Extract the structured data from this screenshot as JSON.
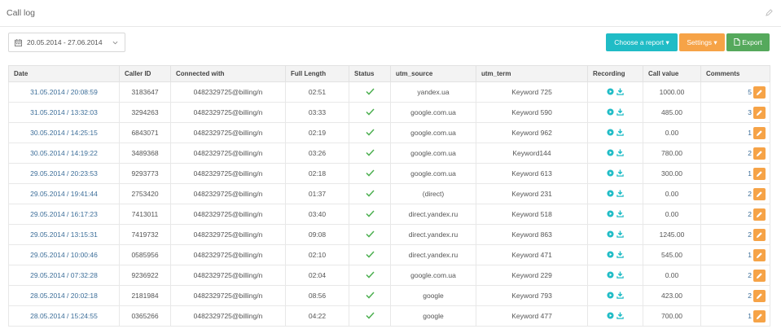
{
  "header": {
    "title": "Call log"
  },
  "toolbar": {
    "date_range": "20.05.2014 - 27.06.2014",
    "report_label": "Choose a report ▾",
    "settings_label": "Settings ▾",
    "export_label": "Export"
  },
  "colors": {
    "accent": "#20bcc6",
    "settings": "#f6a347",
    "export": "#55a95c",
    "link": "#3d6e99",
    "check": "#4caf50"
  },
  "table": {
    "columns": [
      "Date",
      "Caller ID",
      "Connected with",
      "Full Length",
      "Status",
      "utm_source",
      "utm_term",
      "Recording",
      "Call value",
      "Comments"
    ],
    "rows": [
      {
        "date": "31.05.2014 / 20:08:59",
        "caller": "3183647",
        "connected": "0482329725@billing/n",
        "length": "02:51",
        "source": "yandex.ua",
        "term": "Keyword 725",
        "value": "1000.00",
        "comments": "5"
      },
      {
        "date": "31.05.2014 / 13:32:03",
        "caller": "3294263",
        "connected": "0482329725@billing/n",
        "length": "03:33",
        "source": "google.com.ua",
        "term": "Keyword 590",
        "value": "485.00",
        "comments": "3"
      },
      {
        "date": "30.05.2014 / 14:25:15",
        "caller": "6843071",
        "connected": "0482329725@billing/n",
        "length": "02:19",
        "source": "google.com.ua",
        "term": "Keyword 962",
        "value": "0.00",
        "comments": "1"
      },
      {
        "date": "30.05.2014 / 14:19:22",
        "caller": "3489368",
        "connected": "0482329725@billing/n",
        "length": "03:26",
        "source": "google.com.ua",
        "term": "Keyword144",
        "value": "780.00",
        "comments": "2"
      },
      {
        "date": "29.05.2014 / 20:23:53",
        "caller": "9293773",
        "connected": "0482329725@billing/n",
        "length": "02:18",
        "source": "google.com.ua",
        "term": "Keyword 613",
        "value": "300.00",
        "comments": "1"
      },
      {
        "date": "29.05.2014 / 19:41:44",
        "caller": "2753420",
        "connected": "0482329725@billing/n",
        "length": "01:37",
        "source": "(direct)",
        "term": "Keyword 231",
        "value": "0.00",
        "comments": "2"
      },
      {
        "date": "29.05.2014 / 16:17:23",
        "caller": "7413011",
        "connected": "0482329725@billing/n",
        "length": "03:40",
        "source": "direct.yandex.ru",
        "term": "Keyword 518",
        "value": "0.00",
        "comments": "2"
      },
      {
        "date": "29.05.2014 / 13:15:31",
        "caller": "7419732",
        "connected": "0482329725@billing/n",
        "length": "09:08",
        "source": "direct.yandex.ru",
        "term": "Keyword 863",
        "value": "1245.00",
        "comments": "2"
      },
      {
        "date": "29.05.2014 / 10:00:46",
        "caller": "0585956",
        "connected": "0482329725@billing/n",
        "length": "02:10",
        "source": "direct.yandex.ru",
        "term": "Keyword 471",
        "value": "545.00",
        "comments": "1"
      },
      {
        "date": "29.05.2014 / 07:32:28",
        "caller": "9236922",
        "connected": "0482329725@billing/n",
        "length": "02:04",
        "source": "google.com.ua",
        "term": "Keyword 229",
        "value": "0.00",
        "comments": "2"
      },
      {
        "date": "28.05.2014 / 20:02:18",
        "caller": "2181984",
        "connected": "0482329725@billing/n",
        "length": "08:56",
        "source": "google",
        "term": "Keyword 793",
        "value": "423.00",
        "comments": "2"
      },
      {
        "date": "28.05.2014 / 15:24:55",
        "caller": "0365266",
        "connected": "0482329725@billing/n",
        "length": "04:22",
        "source": "google",
        "term": "Keyword 477",
        "value": "700.00",
        "comments": "1"
      }
    ]
  }
}
